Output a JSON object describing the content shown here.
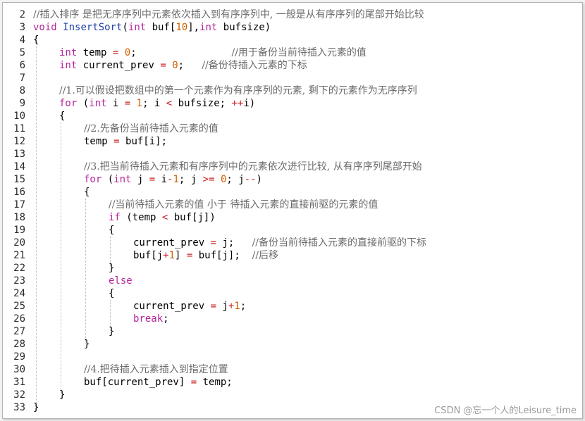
{
  "editor": {
    "line_numbers": [
      "2",
      "3",
      "4",
      "5",
      "6",
      "7",
      "8",
      "9",
      "10",
      "11",
      "12",
      "13",
      "14",
      "15",
      "16",
      "17",
      "18",
      "19",
      "20",
      "21",
      "22",
      "23",
      "24",
      "25",
      "26",
      "27",
      "28",
      "29",
      "30",
      "31",
      "32",
      "33"
    ],
    "code": {
      "l2_cm": "//插入排序 是把无序序列中元素依次插入到有序序列中, 一般是从有序序列的尾部开始比较",
      "l3_kw1": "void",
      "l3_fn": "InsertSort",
      "l3_p1": "(",
      "l3_kw2": "int",
      "l3_p2": " buf[",
      "l3_n": "10",
      "l3_p3": "],",
      "l3_kw3": "int",
      "l3_p4": " bufsize)",
      "l4": "{",
      "l5_kw": "int",
      "l5_a": " temp ",
      "l5_op": "=",
      "l5_sp": " ",
      "l5_n": "0",
      "l5_b": ";                ",
      "l5_cm": "//用于备份当前待插入元素的值",
      "l6_kw": "int",
      "l6_a": " current_prev ",
      "l6_op": "=",
      "l6_sp": " ",
      "l6_n": "0",
      "l6_b": ";   ",
      "l6_cm": "//备份待插入元素的下标",
      "l8_cm": "//1.可以假设把数组中的第一个元素作为有序序列的元素, 剩下的元素作为无序序列",
      "l9_kw": "for",
      "l9_a": " (",
      "l9_kw2": "int",
      "l9_b": " i ",
      "l9_op1": "=",
      "l9_sp": " ",
      "l9_n": "1",
      "l9_c": "; i ",
      "l9_op2": "<",
      "l9_d": " bufsize; ",
      "l9_op3": "++",
      "l9_e": "i)",
      "l10": "{",
      "l11_cm": "//2.先备份当前待插入元素的值",
      "l12_a": "temp ",
      "l12_op": "=",
      "l12_b": " buf[i];",
      "l14_cm": "//3.把当前待插入元素和有序序列中的元素依次进行比较, 从有序序列尾部开始",
      "l15_kw": "for",
      "l15_a": " (",
      "l15_kw2": "int",
      "l15_b": " j ",
      "l15_op1": "=",
      "l15_c": " i",
      "l15_op2": "-",
      "l15_n1": "1",
      "l15_d": "; j ",
      "l15_op3": ">=",
      "l15_sp": " ",
      "l15_n2": "0",
      "l15_e": "; j",
      "l15_op4": "--",
      "l15_f": ")",
      "l16": "{",
      "l17_cm": "//当前待插入元素的值 小于 待插入元素的直接前驱的元素的值",
      "l18_kw": "if",
      "l18_a": " (temp ",
      "l18_op": "<",
      "l18_b": " buf[j])",
      "l19": "{",
      "l20_a": "current_prev ",
      "l20_op": "=",
      "l20_b": " j;   ",
      "l20_cm": "//备份当前待插入元素的直接前驱的下标",
      "l21_a": "buf[j",
      "l21_op1": "+",
      "l21_n": "1",
      "l21_b": "] ",
      "l21_op2": "=",
      "l21_c": " buf[j];  ",
      "l21_cm": "//后移",
      "l22": "}",
      "l23_kw": "else",
      "l24": "{",
      "l25_a": "current_prev ",
      "l25_op1": "=",
      "l25_b": " j",
      "l25_op2": "+",
      "l25_n": "1",
      "l25_c": ";",
      "l26_kw": "break",
      "l26_a": ";",
      "l27": "}",
      "l28": "}",
      "l30_cm": "//4.把待插入元素插入到指定位置",
      "l31_a": "buf[current_prev] ",
      "l31_op": "=",
      "l31_b": " temp;",
      "l32": "}",
      "l33": "}"
    }
  },
  "watermark": "CSDN @忘一个人的Leisure_time",
  "colors": {
    "keyword": "#b5269b",
    "function": "#1a3ea8",
    "number": "#d06000",
    "operator": "#c81e1e",
    "comment": "#6a6a6a"
  }
}
